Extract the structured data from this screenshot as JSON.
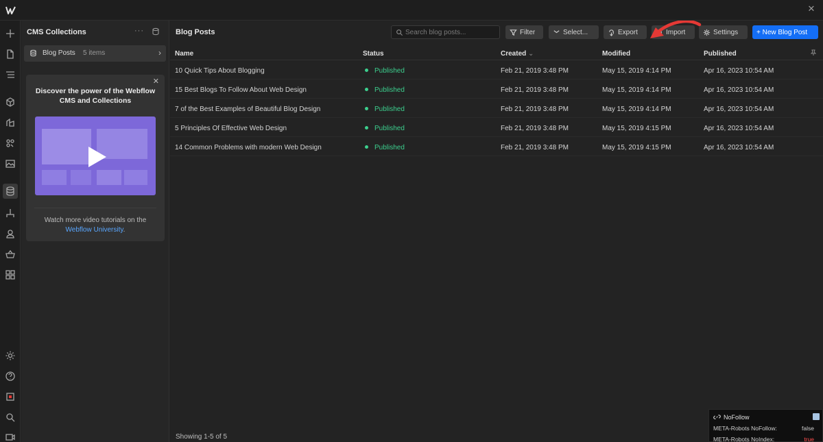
{
  "app": {
    "brand_icon": "webflow-logo-icon"
  },
  "sidebar_icons": [
    "plus-icon",
    "page-icon",
    "navigator-icon",
    "cube-icon",
    "layers-icon",
    "palette-icon",
    "image-icon",
    "database-icon",
    "flow-icon",
    "user-icon",
    "basket-icon",
    "apps-icon",
    "gear-icon",
    "help-icon",
    "record-icon",
    "search-icon",
    "video-icon"
  ],
  "cms_panel": {
    "title": "CMS Collections",
    "more": "···",
    "collection": {
      "name": "Blog Posts",
      "count": "5 items"
    },
    "promo": {
      "title": "Discover the power of the Webflow CMS and Collections",
      "foot_text": "Watch more video tutorials on the",
      "link_text": "Webflow University",
      "link_suffix": "."
    }
  },
  "main": {
    "title": "Blog Posts",
    "search_placeholder": "Search blog posts...",
    "toolbar": {
      "filter": "Filter",
      "select": "Select...",
      "export": "Export",
      "import": "Import",
      "settings": "Settings",
      "new_post": "+ New Blog Post"
    },
    "columns": {
      "name": "Name",
      "status": "Status",
      "created": "Created",
      "modified": "Modified",
      "published": "Published"
    },
    "rows": [
      {
        "name": "10 Quick Tips About Blogging",
        "status": "Published",
        "created": "Feb 21, 2019 3:48 PM",
        "modified": "May 15, 2019 4:14 PM",
        "published": "Apr 16, 2023 10:54 AM"
      },
      {
        "name": "15 Best Blogs To Follow About Web Design",
        "status": "Published",
        "created": "Feb 21, 2019 3:48 PM",
        "modified": "May 15, 2019 4:14 PM",
        "published": "Apr 16, 2023 10:54 AM"
      },
      {
        "name": "7 of the Best Examples of Beautiful Blog Design",
        "status": "Published",
        "created": "Feb 21, 2019 3:48 PM",
        "modified": "May 15, 2019 4:14 PM",
        "published": "Apr 16, 2023 10:54 AM"
      },
      {
        "name": "5 Principles Of Effective Web Design",
        "status": "Published",
        "created": "Feb 21, 2019 3:48 PM",
        "modified": "May 15, 2019 4:15 PM",
        "published": "Apr 16, 2023 10:54 AM"
      },
      {
        "name": "14 Common Problems with modern Web Design",
        "status": "Published",
        "created": "Feb 21, 2019 3:48 PM",
        "modified": "May 15, 2019 4:15 PM",
        "published": "Apr 16, 2023 10:54 AM"
      }
    ],
    "footer": "Showing 1-5 of 5"
  },
  "seo_widget": {
    "title": "NoFollow",
    "rows": [
      {
        "label": "META-Robots NoFollow:",
        "value": "false"
      },
      {
        "label": "META-Robots NoIndex:",
        "value": "true"
      }
    ]
  },
  "colors": {
    "accent": "#146ef5",
    "status_published": "#3ccf8e",
    "annotation_arrow": "#e53935",
    "promo_video": "#7d68d9"
  }
}
